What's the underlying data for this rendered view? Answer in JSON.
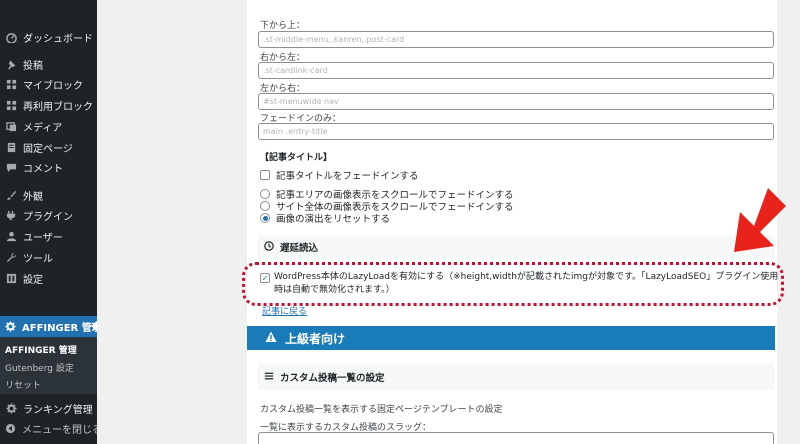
{
  "sidebar": {
    "items": [
      {
        "label": "ダッシュボード",
        "icon": "dashboard-icon"
      },
      {
        "label": "投稿",
        "icon": "pin-icon"
      },
      {
        "label": "マイブロック",
        "icon": "block-icon"
      },
      {
        "label": "再利用ブロック",
        "icon": "block-icon"
      },
      {
        "label": "メディア",
        "icon": "media-icon"
      },
      {
        "label": "固定ページ",
        "icon": "page-icon"
      },
      {
        "label": "コメント",
        "icon": "comment-icon"
      },
      {
        "label": "外観",
        "icon": "brush-icon"
      },
      {
        "label": "プラグイン",
        "icon": "plugin-icon"
      },
      {
        "label": "ユーザー",
        "icon": "user-icon"
      },
      {
        "label": "ツール",
        "icon": "wrench-icon"
      },
      {
        "label": "設定",
        "icon": "settings-icon"
      }
    ],
    "active": {
      "label": "AFFINGER 管理",
      "icon": "gear-icon"
    },
    "submenu": [
      "AFFINGER 管理",
      "Gutenberg 設定",
      "リセット"
    ],
    "bottom": [
      {
        "label": "ランキング管理",
        "icon": "gear-icon"
      },
      {
        "label": "メニューを閉じる",
        "icon": "collapse-icon"
      }
    ]
  },
  "fields": [
    {
      "label": "下から上：",
      "value": ".st-middle-menu,.kanren,.post-card"
    },
    {
      "label": "右から左：",
      "value": ".st-cardlink-card"
    },
    {
      "label": "左から右：",
      "value": "#st-menuwide nav"
    },
    {
      "label": "フェードインのみ：",
      "value": "main .entry-title"
    }
  ],
  "article_title": {
    "heading": "【記事タイトル】",
    "checkbox_label": "記事タイトルをフェードインする",
    "radio_options": [
      "記事エリアの画像表示をスクロールでフェードインする",
      "サイト全体の画像表示をスクロールでフェードインする",
      "画像の演出をリセットする"
    ]
  },
  "lazy": {
    "heading": "遅延読込",
    "text": "WordPress本体のLazyLoadを有効にする（※height,widthが記載されたimgが対象です。「LazyLoadSEO」プラグイン使用時は自動で無効化されます。）"
  },
  "link_text": "記事に戻る",
  "advanced": {
    "title": "上級者向け"
  },
  "custom_post": {
    "heading": "カスタム投稿一覧の設定",
    "description": "カスタム投稿一覧を表示する固定ページテンプレートの設定",
    "slug_label": "一覧に表示するカスタム投稿のスラッグ："
  },
  "colors": {
    "accent": "#2271b1",
    "highlight": "#c8102e",
    "sidebar": "#1d2327",
    "arrow": "#e8231b"
  }
}
